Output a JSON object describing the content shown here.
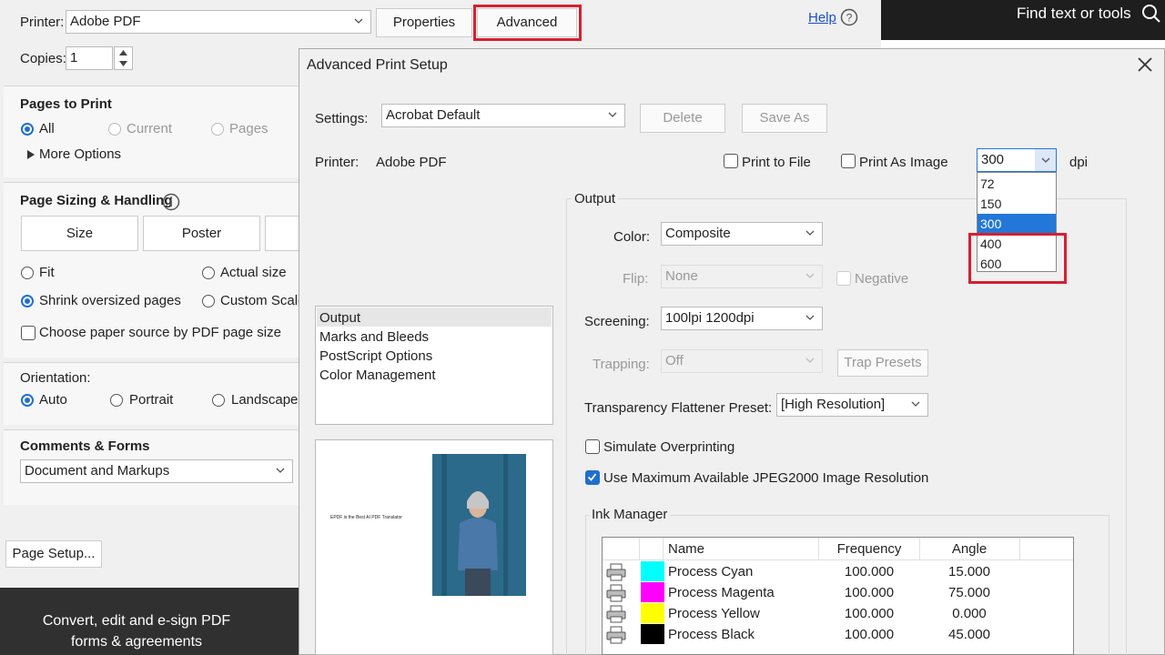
{
  "app_bar": {
    "find_text": "Find text or tools"
  },
  "promo": {
    "line1": "Convert, edit and e-sign PDF",
    "line2": "forms & agreements"
  },
  "print_dialog": {
    "printer_label": "Printer:",
    "printer_value": "Adobe PDF",
    "properties_button": "Properties",
    "advanced_button": "Advanced",
    "help_link": "Help",
    "copies_label": "Copies:",
    "copies_value": "1",
    "pages_to_print": {
      "title": "Pages to Print",
      "all": "All",
      "current": "Current",
      "pages": "Pages",
      "more_options": "More Options"
    },
    "page_sizing": {
      "title": "Page Sizing & Handling",
      "size_button": "Size",
      "poster_button": "Poster",
      "fit": "Fit",
      "actual_size": "Actual size",
      "shrink": "Shrink oversized pages",
      "custom_scale": "Custom Scale",
      "paper_source": "Choose paper source by PDF page size"
    },
    "orientation": {
      "title": "Orientation:",
      "auto": "Auto",
      "portrait": "Portrait",
      "landscape": "Landscape"
    },
    "comments_forms": {
      "title": "Comments & Forms",
      "value": "Document and Markups"
    },
    "page_setup_button": "Page Setup..."
  },
  "advanced_dialog": {
    "title": "Advanced Print Setup",
    "settings_label": "Settings:",
    "settings_value": "Acrobat Default",
    "delete_button": "Delete",
    "save_as_button": "Save As",
    "printer_label": "Printer:",
    "printer_value": "Adobe PDF",
    "print_to_file": "Print to File",
    "print_as_image": "Print As Image",
    "dpi_value": "300",
    "dpi_unit": "dpi",
    "dpi_options": [
      "72",
      "150",
      "300",
      "400",
      "600"
    ],
    "dpi_selected": "300",
    "left_list": [
      "Output",
      "Marks and Bleeds",
      "PostScript Options",
      "Color Management"
    ],
    "preview_text": "EPDF is the Best AI PDF Translator",
    "output": {
      "title": "Output",
      "color_label": "Color:",
      "color_value": "Composite",
      "flip_label": "Flip:",
      "flip_value": "None",
      "negative": "Negative",
      "screening_label": "Screening:",
      "screening_value": "100lpi 1200dpi",
      "trapping_label": "Trapping:",
      "trapping_value": "Off",
      "trap_presets_button": "Trap Presets",
      "flattener_label": "Transparency Flattener Preset:",
      "flattener_value": "[High Resolution]",
      "simulate_overprinting": "Simulate Overprinting",
      "jpeg2000": "Use Maximum Available JPEG2000 Image Resolution"
    },
    "ink_manager": {
      "title": "Ink Manager",
      "columns": [
        "Name",
        "Frequency",
        "Angle"
      ],
      "rows": [
        {
          "name": "Process Cyan",
          "frequency": "100.000",
          "angle": "15.000",
          "color": "#00ffff"
        },
        {
          "name": "Process Magenta",
          "frequency": "100.000",
          "angle": "75.000",
          "color": "#ff00ff"
        },
        {
          "name": "Process Yellow",
          "frequency": "100.000",
          "angle": "0.000",
          "color": "#ffff00"
        },
        {
          "name": "Process Black",
          "frequency": "100.000",
          "angle": "45.000",
          "color": "#000000"
        }
      ]
    }
  },
  "colors": {
    "accent": "#1f6fd0",
    "highlight": "#d62030",
    "selection": "#2277d9"
  }
}
